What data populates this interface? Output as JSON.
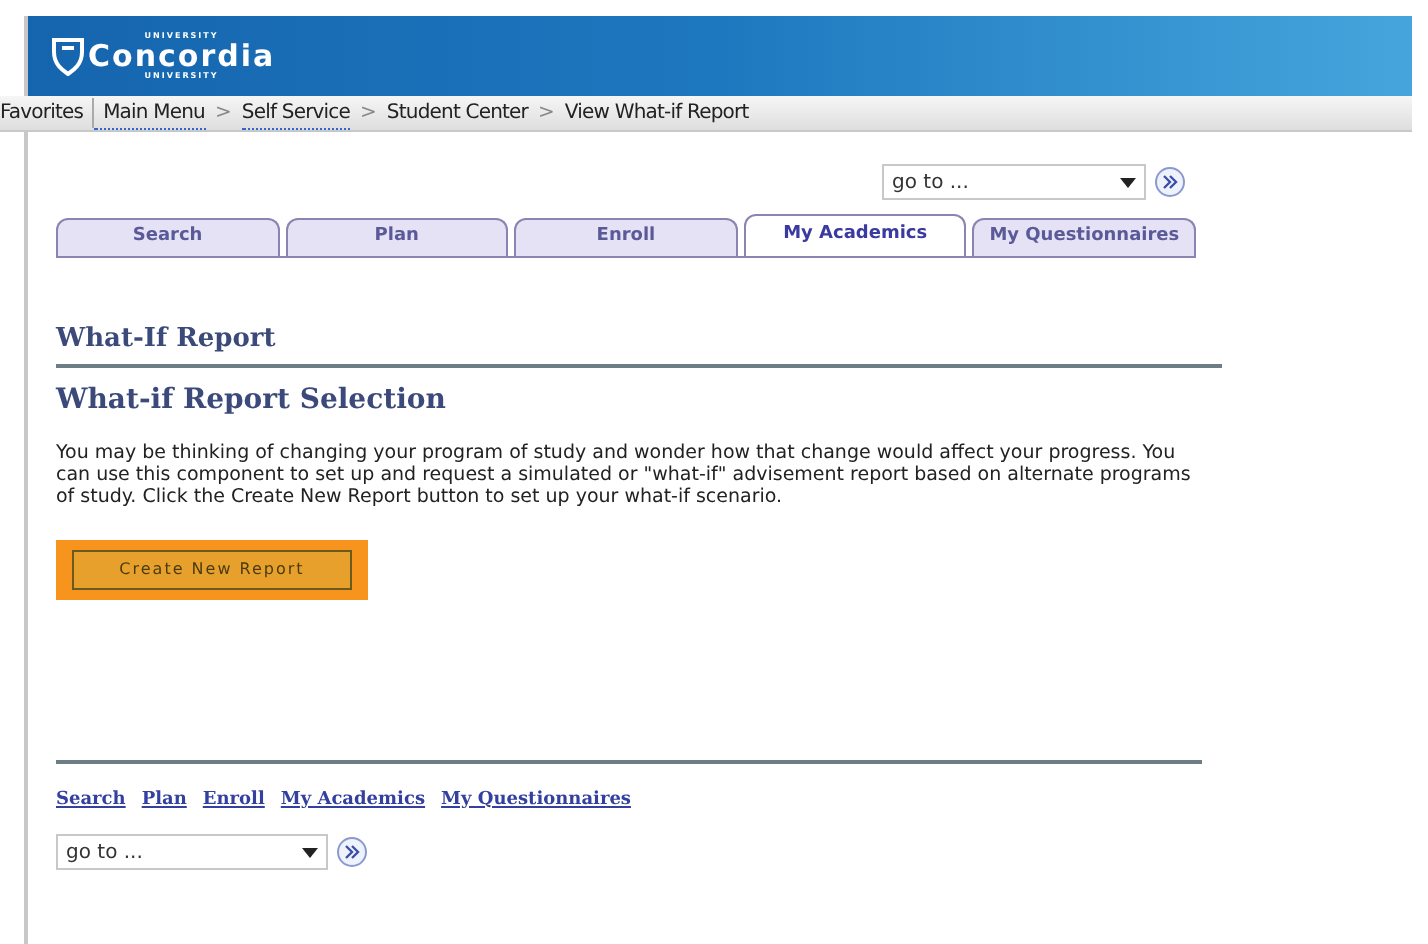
{
  "header": {
    "logo": {
      "top": "UNIVERSITY",
      "name": "Concordia",
      "bottom": "UNIVERSITY"
    }
  },
  "breadcrumb": {
    "favorites": "Favorites",
    "items": [
      {
        "label": "Main Menu",
        "menu": true
      },
      {
        "label": "Self Service",
        "menu": true
      },
      {
        "label": "Student Center",
        "menu": false
      },
      {
        "label": "View What-if Report",
        "menu": false
      }
    ],
    "separator": ">"
  },
  "top_nav": {
    "placeholder": "go to ..."
  },
  "tabs": [
    {
      "label": "Search",
      "selected": false
    },
    {
      "label": "Plan",
      "selected": false
    },
    {
      "label": "Enroll",
      "selected": false
    },
    {
      "label": "My Academics",
      "selected": true
    },
    {
      "label": "My Questionnaires",
      "selected": false
    }
  ],
  "page_title": "What-If Report",
  "section_title": "What-if Report Selection",
  "description": "You may be thinking of changing your program of study and wonder how that change would affect your progress. You can use this component to set up and request a simulated or \"what-if\" advisement report based on alternate programs of study. Click the Create New Report button to set up your what-if scenario.",
  "create_button": "Create New Report",
  "bottom_links": [
    "Search",
    "Plan",
    "Enroll",
    "My Academics",
    "My Questionnaires"
  ],
  "bottom_nav": {
    "placeholder": "go to ..."
  }
}
